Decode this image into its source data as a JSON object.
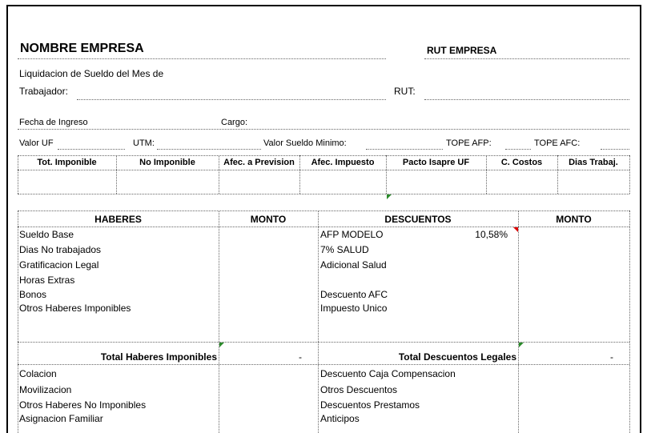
{
  "header": {
    "company_name": "NOMBRE EMPRESA",
    "company_rut": "RUT EMPRESA",
    "liquidation_label": "Liquidacion de Sueldo del Mes de",
    "worker_label": "Trabajador:",
    "rut_label": "RUT:",
    "hire_date_label": "Fecha de Ingreso",
    "position_label": "Cargo:",
    "uf_label": "Valor UF",
    "utm_label": "UTM:",
    "min_wage_label": "Valor Sueldo Minimo:",
    "afp_cap_label": "TOPE AFP:",
    "afc_cap_label": "TOPE AFC:"
  },
  "summary_table": {
    "columns": [
      "Tot. Imponible",
      "No Imponible",
      "Afec. a Prevision",
      "Afec. Impuesto",
      "Pacto Isapre UF",
      "C. Costos",
      "Dias Trabaj."
    ]
  },
  "main_table": {
    "headers": {
      "earnings": "HABERES",
      "amount1": "MONTO",
      "deductions": "DESCUENTOS",
      "amount2": "MONTO"
    },
    "earnings": [
      "Sueldo Base",
      "Dias No trabajados",
      "Gratificacion Legal",
      "Horas Extras",
      "Bonos",
      "Otros Haberes Imponibles"
    ],
    "deductions": [
      "AFP MODELO",
      "7% SALUD",
      "Adicional Salud",
      "",
      "Descuento AFC",
      "Impuesto Unico"
    ],
    "afp_rate": "10,58%",
    "total_taxable_label": "Total Haberes Imponibles",
    "total_taxable_value": "-",
    "total_deductions_label": "Total Descuentos Legales",
    "total_deductions_value": "-",
    "non_taxable": [
      "Colacion",
      "Movilizacion",
      "Otros Haberes No Imponibles",
      "Asignacion Familiar"
    ],
    "other_deductions": [
      "Descuento Caja Compensacion",
      "Otros Descuentos",
      "Descuentos Prestamos",
      "Anticipos"
    ]
  }
}
